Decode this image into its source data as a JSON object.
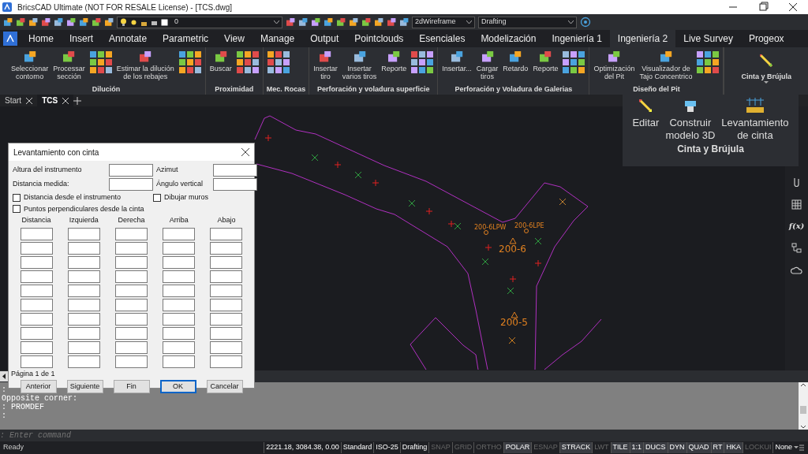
{
  "window": {
    "title": "BricsCAD Ultimate (NOT FOR RESALE License) - [TCS.dwg]"
  },
  "quick_toolbar": {
    "layer": "0",
    "visual_style": "2dWireframe",
    "workspace": "Drafting"
  },
  "ribbon_tabs": [
    {
      "label": "Home",
      "selected": false
    },
    {
      "label": "Insert",
      "selected": false
    },
    {
      "label": "Annotate",
      "selected": false
    },
    {
      "label": "Parametric",
      "selected": false
    },
    {
      "label": "View",
      "selected": false
    },
    {
      "label": "Manage",
      "selected": false
    },
    {
      "label": "Output",
      "selected": false
    },
    {
      "label": "Pointclouds",
      "selected": false
    },
    {
      "label": "Esenciales",
      "selected": false
    },
    {
      "label": "Modelización",
      "selected": false
    },
    {
      "label": "Ingeniería 1",
      "selected": false
    },
    {
      "label": "Ingeniería 2",
      "selected": true
    },
    {
      "label": "Live Survey",
      "selected": false
    },
    {
      "label": "Progeox",
      "selected": false
    }
  ],
  "ribbon_panels": [
    {
      "title": "Dilución",
      "kind": "group",
      "items": [
        {
          "kind": "large",
          "label": "Seleccionar\ncontorno"
        },
        {
          "kind": "large",
          "label": "Processar\nsección"
        },
        {
          "kind": "cluster"
        },
        {
          "kind": "large",
          "label": "Estimar la dilución\nde los rebajes"
        },
        {
          "kind": "cluster"
        }
      ]
    },
    {
      "title": "Proximidad",
      "kind": "group",
      "items": [
        {
          "kind": "large",
          "label": "Buscar"
        },
        {
          "kind": "cluster"
        }
      ]
    },
    {
      "title": "Mec. Rocas",
      "kind": "group",
      "items": [
        {
          "kind": "cluster"
        }
      ]
    },
    {
      "title": "Perforación y voladura superficie",
      "kind": "group",
      "items": [
        {
          "kind": "large",
          "label": "Insertar\ntiro"
        },
        {
          "kind": "large",
          "label": "Insertar\nvarios tiros"
        },
        {
          "kind": "large",
          "label": "Reporte"
        },
        {
          "kind": "cluster"
        }
      ]
    },
    {
      "title": "Perforación y Voladura de Galerias",
      "kind": "group",
      "items": [
        {
          "kind": "large",
          "label": "Insertar..."
        },
        {
          "kind": "large",
          "label": "Cargar\ntiros"
        },
        {
          "kind": "large",
          "label": "Retardo"
        },
        {
          "kind": "large",
          "label": "Reporte"
        },
        {
          "kind": "cluster"
        }
      ]
    },
    {
      "title": "Diseño del Pit",
      "kind": "group",
      "items": [
        {
          "kind": "large",
          "label": "Optimización\ndel Pit"
        },
        {
          "kind": "large",
          "label": "Visualizador de\nTajo Concentrico"
        },
        {
          "kind": "cluster"
        }
      ]
    },
    {
      "title": "Cinta y Brújula",
      "kind": "collapsed"
    }
  ],
  "doc_tabs": [
    {
      "label": "Start",
      "selected": false
    },
    {
      "label": "TCS",
      "selected": true
    }
  ],
  "drawing": {
    "labels": [
      "200-6LPW",
      "200-6LPE",
      "200-6",
      "200-5"
    ]
  },
  "flyout": {
    "title": "Cinta y Brújula",
    "items": [
      "Editar",
      "Construir\nmodelo 3D",
      "Levantamiento\nde cinta"
    ]
  },
  "side_toolbar": [
    {
      "kind": "paperclip"
    },
    {
      "kind": "grid"
    },
    {
      "kind": "text",
      "text": "f(x)"
    },
    {
      "kind": "tree"
    },
    {
      "kind": "cloud"
    }
  ],
  "dialog": {
    "title": "Levantamiento con cinta",
    "fields": [
      {
        "label": "Altura del instrumento"
      },
      {
        "label": "Azimut"
      },
      {
        "label": "Distancia medida:"
      },
      {
        "label": "Ángulo vertical"
      }
    ],
    "checkboxes": [
      {
        "label": "Distancia desde el instrumento",
        "checked": false
      },
      {
        "label": "Dibujar muros",
        "checked": false
      },
      {
        "label": "Puntos perpendiculares desde la cinta",
        "checked": false
      }
    ],
    "columns": [
      "Distancia",
      "Izquierda",
      "Derecha",
      "Arriba",
      "Abajo"
    ],
    "page": "Página 1 de 1",
    "buttons": [
      {
        "label": "Anterior",
        "default": false
      },
      {
        "label": "Siguiente",
        "default": false
      },
      {
        "label": "Fin",
        "default": false
      },
      {
        "label": "OK",
        "default": true
      },
      {
        "label": "Cancelar",
        "default": false
      }
    ]
  },
  "command_history": [
    ":",
    "Opposite corner:",
    ": PROMDEF",
    ":"
  ],
  "command_prompt": {
    "placeholder": ": Enter command"
  },
  "status_bar": {
    "state": "Ready",
    "readouts": [
      "2221.18, 3084.38, 0.00",
      "Standard",
      "ISO-25",
      "Drafting"
    ],
    "toggles": [
      {
        "label": "SNAP",
        "on": false
      },
      {
        "label": "GRID",
        "on": false
      },
      {
        "label": "ORTHO",
        "on": false
      },
      {
        "label": "POLAR",
        "on": true
      },
      {
        "label": "ESNAP",
        "on": false
      },
      {
        "label": "STRACK",
        "on": true
      },
      {
        "label": "LWT",
        "on": false
      },
      {
        "label": "TILE",
        "on": true
      },
      {
        "label": "1:1",
        "on": true
      },
      {
        "label": "DUCS",
        "on": true
      },
      {
        "label": "DYN",
        "on": true
      },
      {
        "label": "QUAD",
        "on": true
      },
      {
        "label": "RT",
        "on": true
      },
      {
        "label": "HKA",
        "on": true
      },
      {
        "label": "LOCKUI",
        "on": false
      }
    ],
    "annotation_scale": "None"
  }
}
